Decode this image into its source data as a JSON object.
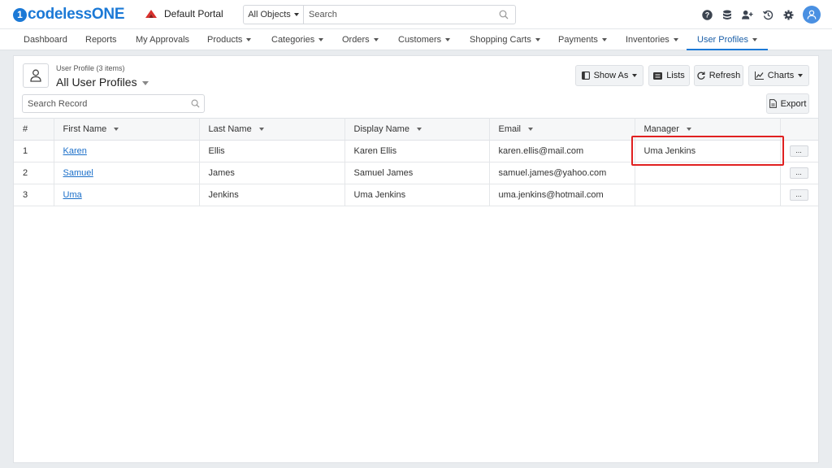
{
  "header": {
    "logo_text": "codelessONE",
    "logo_mark": "1",
    "portal_name": "Default Portal",
    "search_scope": "All Objects",
    "search_placeholder": "Search",
    "icons": [
      "help-icon",
      "database-icon",
      "add-user-icon",
      "history-icon",
      "gear-icon",
      "avatar-icon"
    ]
  },
  "nav": {
    "items": [
      {
        "label": "Dashboard",
        "dropdown": false
      },
      {
        "label": "Reports",
        "dropdown": false
      },
      {
        "label": "My Approvals",
        "dropdown": false
      },
      {
        "label": "Products",
        "dropdown": true
      },
      {
        "label": "Categories",
        "dropdown": true
      },
      {
        "label": "Orders",
        "dropdown": true
      },
      {
        "label": "Customers",
        "dropdown": true
      },
      {
        "label": "Shopping Carts",
        "dropdown": true
      },
      {
        "label": "Payments",
        "dropdown": true
      },
      {
        "label": "Inventories",
        "dropdown": true
      },
      {
        "label": "User Profiles",
        "dropdown": true,
        "active": true
      }
    ]
  },
  "list": {
    "object_count": "User Profile (3 items)",
    "view_title": "All User Profiles",
    "search_placeholder": "Search Record",
    "buttons": {
      "show_as": "Show As",
      "lists": "Lists",
      "refresh": "Refresh",
      "charts": "Charts",
      "export": "Export"
    },
    "columns": [
      "#",
      "First Name",
      "Last Name",
      "Display Name",
      "Email",
      "Manager"
    ],
    "rows": [
      {
        "num": "1",
        "first_name": "Karen",
        "last_name": "Ellis",
        "display_name": "Karen Ellis",
        "email": "karen.ellis@mail.com",
        "manager": "Uma Jenkins",
        "more": "..."
      },
      {
        "num": "2",
        "first_name": "Samuel",
        "last_name": "James",
        "display_name": "Samuel James",
        "email": "samuel.james@yahoo.com",
        "manager": "",
        "more": "..."
      },
      {
        "num": "3",
        "first_name": "Uma",
        "last_name": "Jenkins",
        "display_name": "Uma Jenkins",
        "email": "uma.jenkins@hotmail.com",
        "manager": "",
        "more": "..."
      }
    ]
  },
  "colors": {
    "brand": "#1b79d6",
    "active_tab": "#1b5fa8",
    "highlight": "#e02020",
    "link": "#1b6fc9"
  }
}
